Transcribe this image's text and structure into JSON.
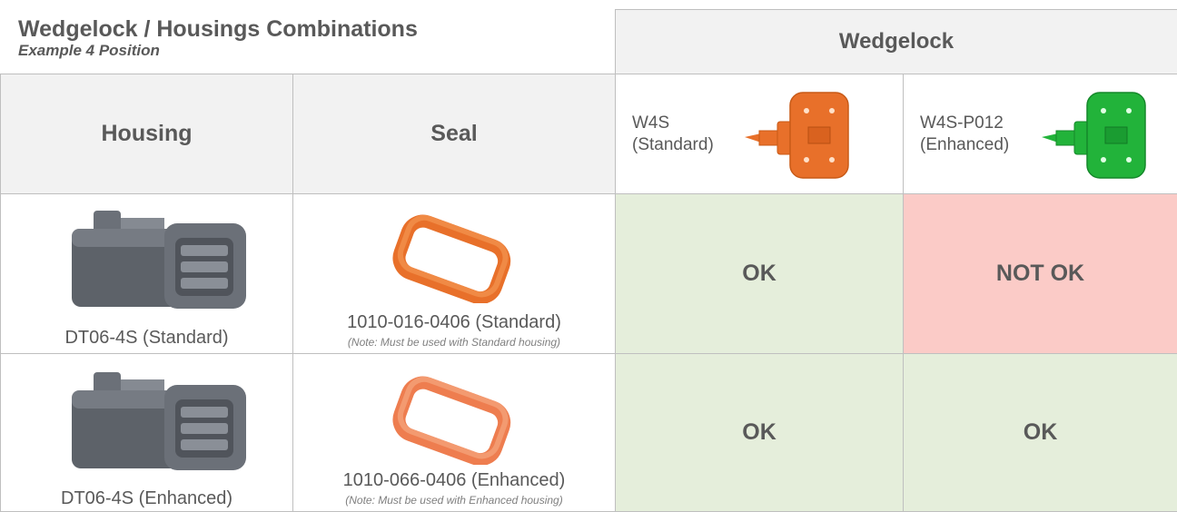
{
  "title": "Wedgelock / Housings Combinations",
  "subtitle": "Example 4 Position",
  "wedgelock_header": "Wedgelock",
  "columns": {
    "housing": "Housing",
    "seal": "Seal"
  },
  "wedgelocks": [
    {
      "line1": "W4S",
      "line2": "(Standard)",
      "color": "#e8702a"
    },
    {
      "line1": "W4S-P012",
      "line2": "(Enhanced)",
      "color": "#22b33a"
    }
  ],
  "rows": [
    {
      "housing": "DT06-4S (Standard)",
      "seal": "1010-016-0406 (Standard)",
      "seal_note": "(Note: Must be used with Standard housing)",
      "seal_color": "#e8702a",
      "results": [
        "OK",
        "NOT OK"
      ]
    },
    {
      "housing": "DT06-4S (Enhanced)",
      "seal": "1010-066-0406 (Enhanced)",
      "seal_note": "(Note: Must be used with Enhanced housing)",
      "seal_color": "#ee7d4f",
      "results": [
        "OK",
        "OK"
      ]
    }
  ],
  "colors": {
    "ok": "#e5eedb",
    "not_ok": "#fbcbc7",
    "header": "#f2f2f2",
    "text": "#595959"
  }
}
